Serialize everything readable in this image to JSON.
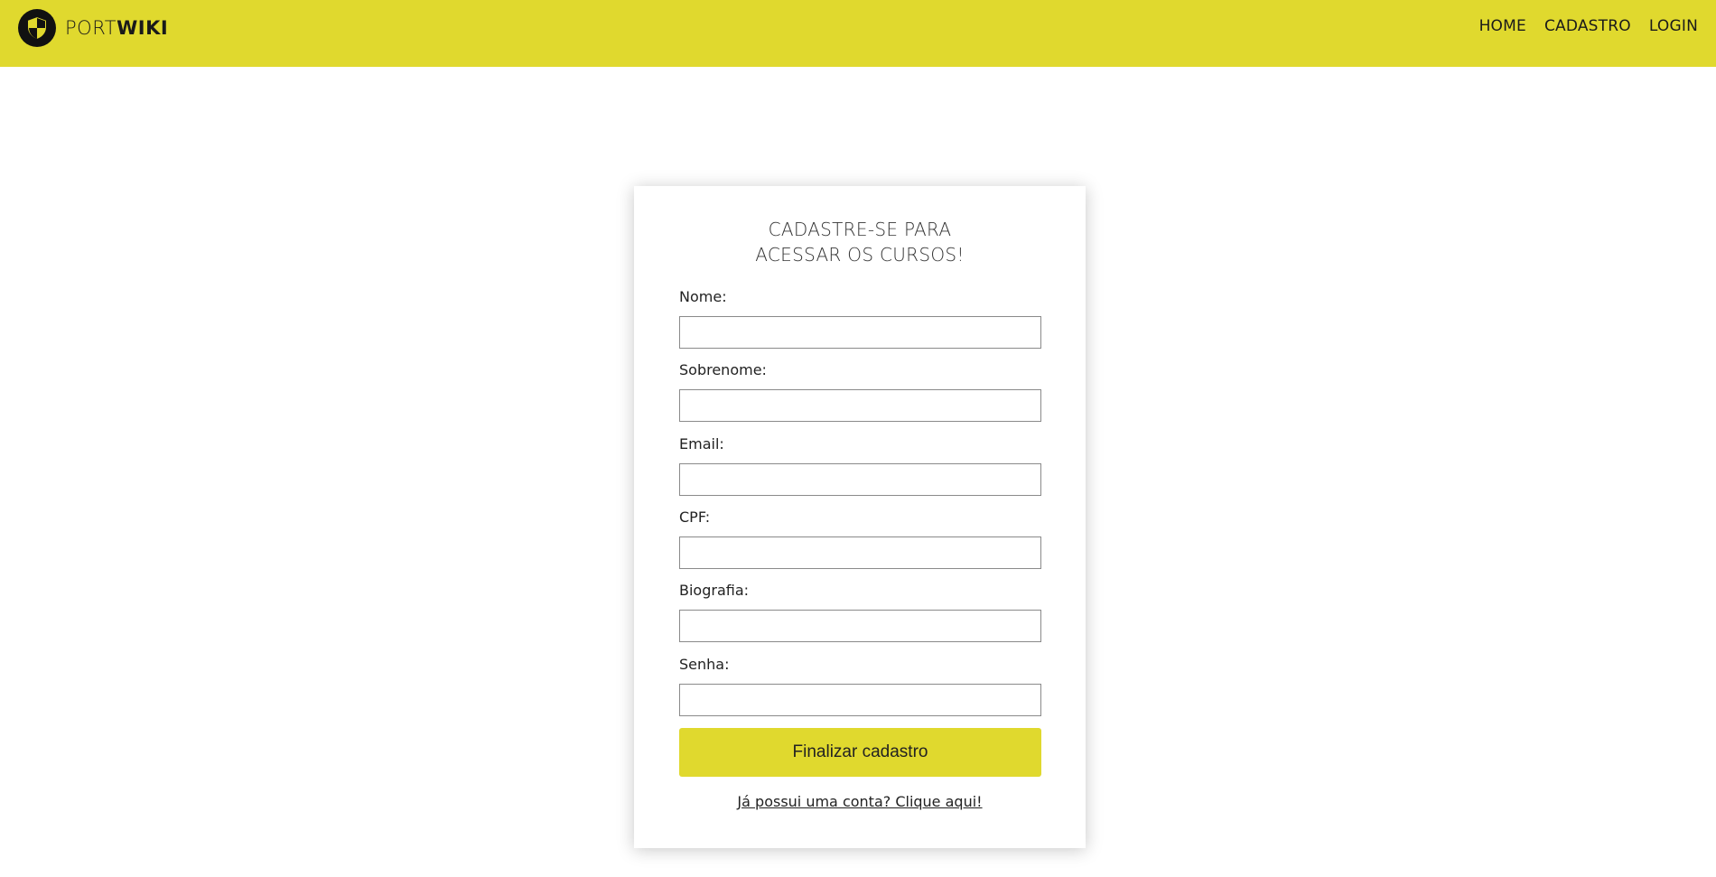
{
  "brand": {
    "light": "PORT",
    "bold": "WIKI",
    "logo_icon": "shield-icon"
  },
  "nav": {
    "home": "HOME",
    "cadastro": "CADASTRO",
    "login": "LOGIN"
  },
  "form": {
    "title_line1": "CADASTRE-SE PARA",
    "title_line2": "ACESSAR OS CURSOS!",
    "fields": [
      {
        "label": "Nome:",
        "value": ""
      },
      {
        "label": "Sobrenome:",
        "value": ""
      },
      {
        "label": "Email:",
        "value": ""
      },
      {
        "label": "CPF:",
        "value": ""
      },
      {
        "label": "Biografia:",
        "value": ""
      },
      {
        "label": "Senha:",
        "value": ""
      }
    ],
    "submit_label": "Finalizar cadastro",
    "login_link": "Já possui uma conta? Clique aqui!"
  },
  "colors": {
    "accent": "#e0d92e",
    "dark": "#111111"
  }
}
